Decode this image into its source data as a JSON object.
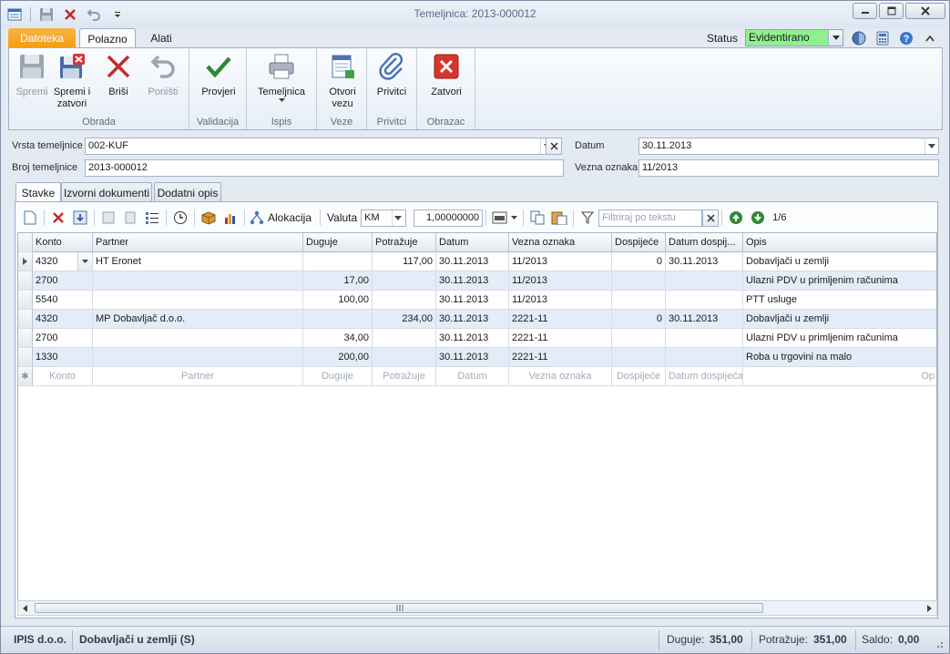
{
  "window": {
    "title": "Temeljnica: 2013-000012"
  },
  "ribbon_tabs": {
    "file": "Datoteka",
    "home": "Polazno",
    "tools": "Alati"
  },
  "status": {
    "label": "Status",
    "value": "Evidentirano",
    "color": "#8ef08e"
  },
  "ribbon": {
    "groups": {
      "obrada": "Obrada",
      "validacija": "Validacija",
      "ispis": "Ispis",
      "veze": "Veze",
      "privitci": "Privitci",
      "obrazac": "Obrazac"
    },
    "buttons": {
      "spremi": "Spremi",
      "spremi_zatvori": "Spremi i\nzatvori",
      "brisi": "Briši",
      "ponisti": "Poništi",
      "provjeri": "Provjeri",
      "temeljnica": "Temeljnica",
      "otvori_vezu": "Otvori\nvezu",
      "privitci": "Privitci",
      "zatvori": "Zatvori"
    }
  },
  "form": {
    "vrsta_label": "Vrsta temeljnice",
    "vrsta_value": "002-KUF",
    "broj_label": "Broj temeljnice",
    "broj_value": "2013-000012",
    "datum_label": "Datum",
    "datum_value": "30.11.2013",
    "vezna_label": "Vezna oznaka",
    "vezna_value": "11/2013"
  },
  "detail_tabs": [
    "Stavke",
    "Izvorni dokumenti",
    "Dodatni opis"
  ],
  "toolbar": {
    "alokacija": "Alokacija",
    "valuta_label": "Valuta",
    "valuta_value": "KM",
    "tecaj": "1,00000000",
    "filter_placeholder": "Filtriraj po tekstu",
    "pager": "1/6"
  },
  "grid": {
    "columns": [
      "Konto",
      "Partner",
      "Duguje",
      "Potražuje",
      "Datum",
      "Vezna oznaka",
      "Dospijeće",
      "Datum dospij...",
      "Opis"
    ],
    "rows": [
      [
        "4320",
        "HT Eronet",
        "",
        "117,00",
        "30.11.2013",
        "11/2013",
        "0",
        "30.11.2013",
        "Dobavljači u zemlji"
      ],
      [
        "2700",
        "",
        "17,00",
        "",
        "30.11.2013",
        "11/2013",
        "",
        "",
        "Ulazni PDV u primljenim računima"
      ],
      [
        "5540",
        "",
        "100,00",
        "",
        "30.11.2013",
        "11/2013",
        "",
        "",
        "PTT usluge"
      ],
      [
        "4320",
        "MP Dobavljač d.o.o.",
        "",
        "234,00",
        "30.11.2013",
        "2221-11",
        "0",
        "30.11.2013",
        "Dobavljači u zemlji"
      ],
      [
        "2700",
        "",
        "34,00",
        "",
        "30.11.2013",
        "2221-11",
        "",
        "",
        "Ulazni PDV u primljenim računima"
      ],
      [
        "1330",
        "",
        "200,00",
        "",
        "30.11.2013",
        "2221-11",
        "",
        "",
        "Roba u trgovini na malo"
      ]
    ],
    "new_row": [
      "Konto",
      "Partner",
      "Duguje",
      "Potražuje",
      "Datum",
      "Vezna oznaka",
      "Dospijeće",
      "Datum dospijeća",
      "Op"
    ]
  },
  "statusbar": {
    "company": "IPIS d.o.o.",
    "document": "Dobavljači u zemlji (S)",
    "duguje_label": "Duguje:",
    "duguje_value": "351,00",
    "potrazuje_label": "Potražuje:",
    "potrazuje_value": "351,00",
    "saldo_label": "Saldo:",
    "saldo_value": "0,00"
  }
}
